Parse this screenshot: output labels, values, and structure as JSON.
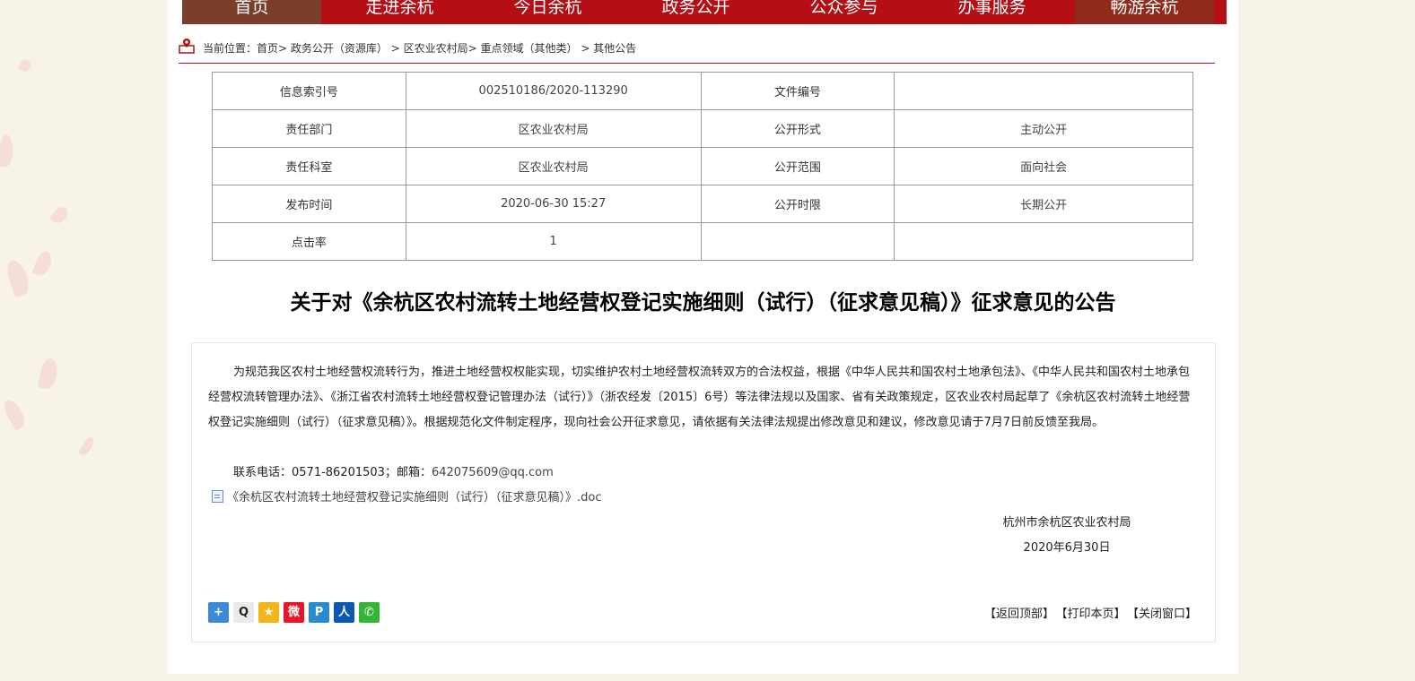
{
  "nav": {
    "items": [
      "首页",
      "走进余杭",
      "今日余杭",
      "政务公开",
      "公众参与",
      "办事服务",
      "畅游余杭"
    ]
  },
  "breadcrumb": {
    "label": "当前位置：",
    "items": [
      "首页",
      "政务公开（资源库）",
      "区农业农村局",
      "重点领域（其他类）",
      "其他公告"
    ]
  },
  "meta_table": {
    "rows": [
      [
        "信息索引号",
        "002510186/2020-113290",
        "文件编号",
        ""
      ],
      [
        "责任部门",
        "区农业农村局",
        "公开形式",
        "主动公开"
      ],
      [
        "责任科室",
        "区农业农村局",
        "公开范围",
        "面向社会"
      ],
      [
        "发布时间",
        "2020-06-30 15:27",
        "公开时限",
        "长期公开"
      ],
      [
        "点击率",
        "1",
        "",
        ""
      ]
    ]
  },
  "article": {
    "title": "关于对《余杭区农村流转土地经营权登记实施细则（试行）（征求意见稿）》征求意见的公告",
    "body": "为规范我区农村土地经营权流转行为，推进土地经营权权能实现，切实维护农村土地经营权流转双方的合法权益，根据《中华人民共和国农村土地承包法》、《中华人民共和国农村土地承包经营权流转管理办法》、《浙江省农村流转土地经营权登记管理办法（试行）》（浙农经发〔2015〕6号）等法律法规以及国家、省有关政策规定，区农业农村局起草了《余杭区农村流转土地经营权登记实施细则（试行）（征求意见稿）》。根据规范化文件制定程序，现向社会公开征求意见，请依据有关法律法规提出修改意见和建议，修改意见请于7月7日前反馈至我局。",
    "contact_prefix": "联系电话：0571-86201503；邮箱：",
    "email": "642075609@qq.com",
    "attachment": "《余杭区农村流转土地经营权登记实施细则（试行）（征求意见稿）》.doc",
    "signature_org": "杭州市余杭区农业农村局",
    "signature_date": "2020年6月30日"
  },
  "share_icons": [
    {
      "name": "share-more-icon",
      "color": "#3a8ad6",
      "glyph": "+"
    },
    {
      "name": "qq-icon",
      "color": "#f0f0f0",
      "glyph": "🐧"
    },
    {
      "name": "qzone-icon",
      "color": "#f2b51a",
      "glyph": "★"
    },
    {
      "name": "weibo-icon",
      "color": "#e6162d",
      "glyph": "微"
    },
    {
      "name": "tencent-weibo-icon",
      "color": "#2a8bd3",
      "glyph": "Ⓟ"
    },
    {
      "name": "renren-icon",
      "color": "#0b57b4",
      "glyph": "人"
    },
    {
      "name": "wechat-icon",
      "color": "#33b536",
      "glyph": "✆"
    }
  ],
  "footer_links": [
    "【返回顶部】",
    "【打印本页】",
    "【关闭窗口】"
  ],
  "colors": {
    "brand_red": "#b50e14",
    "home_tab": "#7b3e2a"
  }
}
